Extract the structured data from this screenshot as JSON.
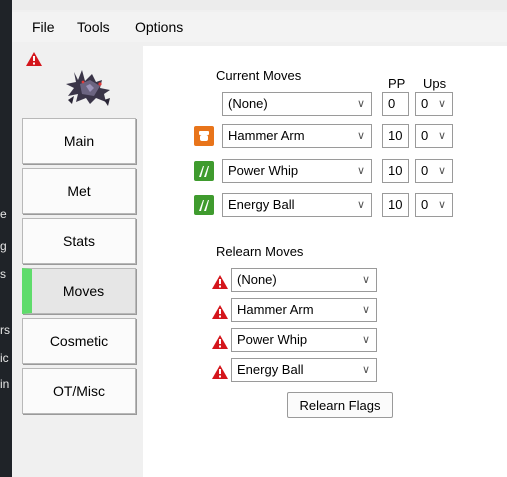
{
  "menu": {
    "file": "File",
    "tools": "Tools",
    "options": "Options"
  },
  "background_fragments": [
    "e",
    "g",
    "s",
    "rs",
    "ic",
    "in"
  ],
  "nav": [
    {
      "label": "Main"
    },
    {
      "label": "Met"
    },
    {
      "label": "Stats"
    },
    {
      "label": "Moves",
      "active": true
    },
    {
      "label": "Cosmetic"
    },
    {
      "label": "OT/Misc"
    }
  ],
  "current_moves": {
    "header": "Current Moves",
    "pp_header": "PP",
    "ups_header": "Ups",
    "rows": [
      {
        "move": "(None)",
        "pp": "0",
        "ups": "0",
        "type_icon": null
      },
      {
        "move": "Hammer Arm",
        "pp": "10",
        "ups": "0",
        "type_icon": "fighting-type-icon",
        "type_color": "#e8741a"
      },
      {
        "move": "Power Whip",
        "pp": "10",
        "ups": "0",
        "type_icon": "grass-type-icon",
        "type_color": "#3f9b2e"
      },
      {
        "move": "Energy Ball",
        "pp": "10",
        "ups": "0",
        "type_icon": "grass-type-icon",
        "type_color": "#3f9b2e"
      }
    ]
  },
  "relearn_moves": {
    "header": "Relearn Moves",
    "rows": [
      {
        "move": "(None)"
      },
      {
        "move": "Hammer Arm"
      },
      {
        "move": "Power Whip"
      },
      {
        "move": "Energy Ball"
      }
    ],
    "flags_button": "Relearn Flags"
  },
  "colors": {
    "active_tab_accent": "#5fdc6b",
    "warning": "#d4161c"
  }
}
